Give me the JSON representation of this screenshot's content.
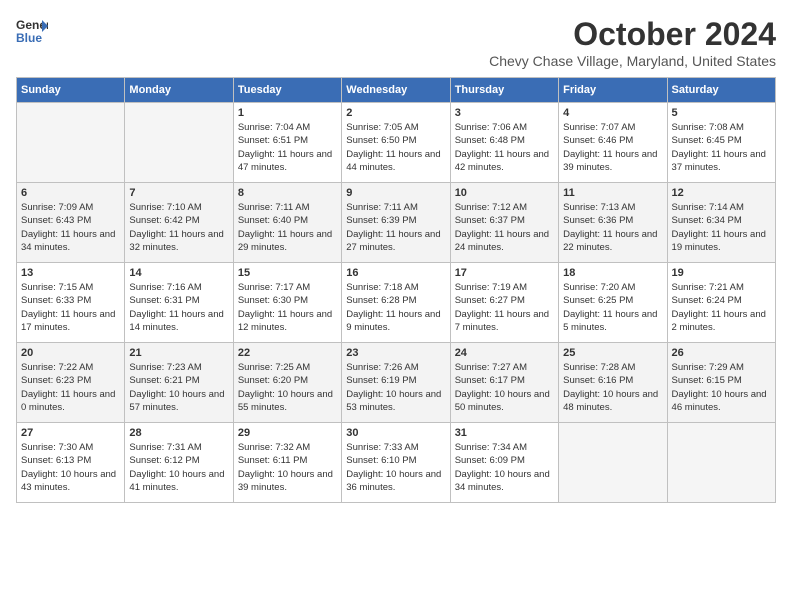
{
  "header": {
    "logo_line1": "General",
    "logo_line2": "Blue",
    "month": "October 2024",
    "location": "Chevy Chase Village, Maryland, United States"
  },
  "weekdays": [
    "Sunday",
    "Monday",
    "Tuesday",
    "Wednesday",
    "Thursday",
    "Friday",
    "Saturday"
  ],
  "weeks": [
    [
      {
        "day": "",
        "empty": true
      },
      {
        "day": "",
        "empty": true
      },
      {
        "day": "1",
        "sunrise": "Sunrise: 7:04 AM",
        "sunset": "Sunset: 6:51 PM",
        "daylight": "Daylight: 11 hours and 47 minutes."
      },
      {
        "day": "2",
        "sunrise": "Sunrise: 7:05 AM",
        "sunset": "Sunset: 6:50 PM",
        "daylight": "Daylight: 11 hours and 44 minutes."
      },
      {
        "day": "3",
        "sunrise": "Sunrise: 7:06 AM",
        "sunset": "Sunset: 6:48 PM",
        "daylight": "Daylight: 11 hours and 42 minutes."
      },
      {
        "day": "4",
        "sunrise": "Sunrise: 7:07 AM",
        "sunset": "Sunset: 6:46 PM",
        "daylight": "Daylight: 11 hours and 39 minutes."
      },
      {
        "day": "5",
        "sunrise": "Sunrise: 7:08 AM",
        "sunset": "Sunset: 6:45 PM",
        "daylight": "Daylight: 11 hours and 37 minutes."
      }
    ],
    [
      {
        "day": "6",
        "sunrise": "Sunrise: 7:09 AM",
        "sunset": "Sunset: 6:43 PM",
        "daylight": "Daylight: 11 hours and 34 minutes."
      },
      {
        "day": "7",
        "sunrise": "Sunrise: 7:10 AM",
        "sunset": "Sunset: 6:42 PM",
        "daylight": "Daylight: 11 hours and 32 minutes."
      },
      {
        "day": "8",
        "sunrise": "Sunrise: 7:11 AM",
        "sunset": "Sunset: 6:40 PM",
        "daylight": "Daylight: 11 hours and 29 minutes."
      },
      {
        "day": "9",
        "sunrise": "Sunrise: 7:11 AM",
        "sunset": "Sunset: 6:39 PM",
        "daylight": "Daylight: 11 hours and 27 minutes."
      },
      {
        "day": "10",
        "sunrise": "Sunrise: 7:12 AM",
        "sunset": "Sunset: 6:37 PM",
        "daylight": "Daylight: 11 hours and 24 minutes."
      },
      {
        "day": "11",
        "sunrise": "Sunrise: 7:13 AM",
        "sunset": "Sunset: 6:36 PM",
        "daylight": "Daylight: 11 hours and 22 minutes."
      },
      {
        "day": "12",
        "sunrise": "Sunrise: 7:14 AM",
        "sunset": "Sunset: 6:34 PM",
        "daylight": "Daylight: 11 hours and 19 minutes."
      }
    ],
    [
      {
        "day": "13",
        "sunrise": "Sunrise: 7:15 AM",
        "sunset": "Sunset: 6:33 PM",
        "daylight": "Daylight: 11 hours and 17 minutes."
      },
      {
        "day": "14",
        "sunrise": "Sunrise: 7:16 AM",
        "sunset": "Sunset: 6:31 PM",
        "daylight": "Daylight: 11 hours and 14 minutes."
      },
      {
        "day": "15",
        "sunrise": "Sunrise: 7:17 AM",
        "sunset": "Sunset: 6:30 PM",
        "daylight": "Daylight: 11 hours and 12 minutes."
      },
      {
        "day": "16",
        "sunrise": "Sunrise: 7:18 AM",
        "sunset": "Sunset: 6:28 PM",
        "daylight": "Daylight: 11 hours and 9 minutes."
      },
      {
        "day": "17",
        "sunrise": "Sunrise: 7:19 AM",
        "sunset": "Sunset: 6:27 PM",
        "daylight": "Daylight: 11 hours and 7 minutes."
      },
      {
        "day": "18",
        "sunrise": "Sunrise: 7:20 AM",
        "sunset": "Sunset: 6:25 PM",
        "daylight": "Daylight: 11 hours and 5 minutes."
      },
      {
        "day": "19",
        "sunrise": "Sunrise: 7:21 AM",
        "sunset": "Sunset: 6:24 PM",
        "daylight": "Daylight: 11 hours and 2 minutes."
      }
    ],
    [
      {
        "day": "20",
        "sunrise": "Sunrise: 7:22 AM",
        "sunset": "Sunset: 6:23 PM",
        "daylight": "Daylight: 11 hours and 0 minutes."
      },
      {
        "day": "21",
        "sunrise": "Sunrise: 7:23 AM",
        "sunset": "Sunset: 6:21 PM",
        "daylight": "Daylight: 10 hours and 57 minutes."
      },
      {
        "day": "22",
        "sunrise": "Sunrise: 7:25 AM",
        "sunset": "Sunset: 6:20 PM",
        "daylight": "Daylight: 10 hours and 55 minutes."
      },
      {
        "day": "23",
        "sunrise": "Sunrise: 7:26 AM",
        "sunset": "Sunset: 6:19 PM",
        "daylight": "Daylight: 10 hours and 53 minutes."
      },
      {
        "day": "24",
        "sunrise": "Sunrise: 7:27 AM",
        "sunset": "Sunset: 6:17 PM",
        "daylight": "Daylight: 10 hours and 50 minutes."
      },
      {
        "day": "25",
        "sunrise": "Sunrise: 7:28 AM",
        "sunset": "Sunset: 6:16 PM",
        "daylight": "Daylight: 10 hours and 48 minutes."
      },
      {
        "day": "26",
        "sunrise": "Sunrise: 7:29 AM",
        "sunset": "Sunset: 6:15 PM",
        "daylight": "Daylight: 10 hours and 46 minutes."
      }
    ],
    [
      {
        "day": "27",
        "sunrise": "Sunrise: 7:30 AM",
        "sunset": "Sunset: 6:13 PM",
        "daylight": "Daylight: 10 hours and 43 minutes."
      },
      {
        "day": "28",
        "sunrise": "Sunrise: 7:31 AM",
        "sunset": "Sunset: 6:12 PM",
        "daylight": "Daylight: 10 hours and 41 minutes."
      },
      {
        "day": "29",
        "sunrise": "Sunrise: 7:32 AM",
        "sunset": "Sunset: 6:11 PM",
        "daylight": "Daylight: 10 hours and 39 minutes."
      },
      {
        "day": "30",
        "sunrise": "Sunrise: 7:33 AM",
        "sunset": "Sunset: 6:10 PM",
        "daylight": "Daylight: 10 hours and 36 minutes."
      },
      {
        "day": "31",
        "sunrise": "Sunrise: 7:34 AM",
        "sunset": "Sunset: 6:09 PM",
        "daylight": "Daylight: 10 hours and 34 minutes."
      },
      {
        "day": "",
        "empty": true
      },
      {
        "day": "",
        "empty": true
      }
    ]
  ]
}
